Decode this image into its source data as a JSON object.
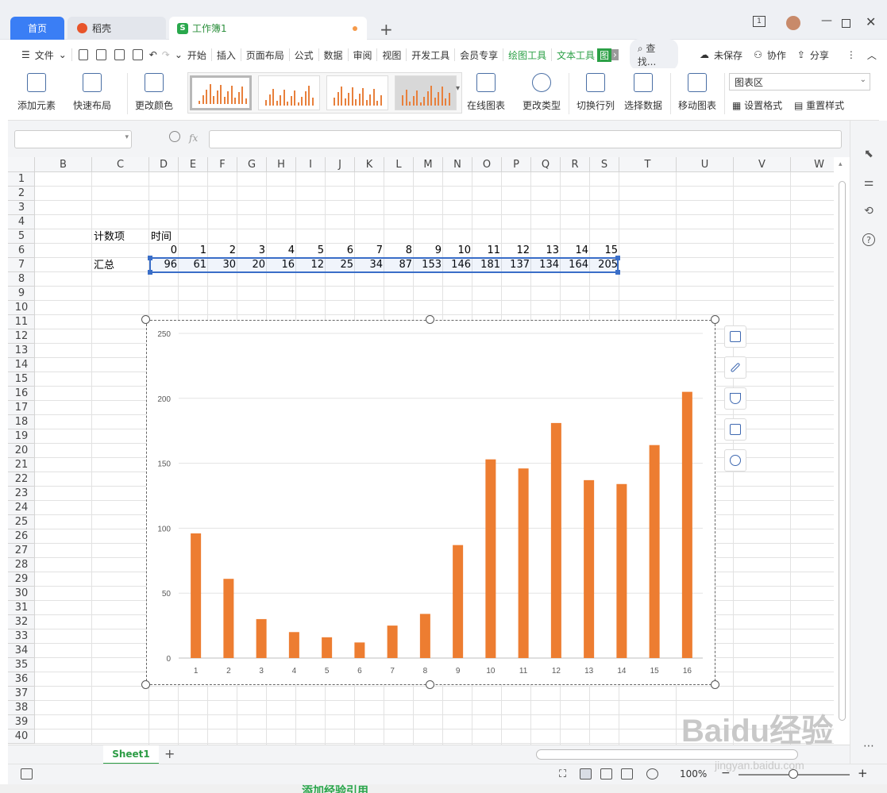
{
  "titlebar": {
    "tabs": [
      {
        "label": "首页"
      },
      {
        "label": "稻壳"
      },
      {
        "label": "工作簿1"
      }
    ],
    "window_badge": "1"
  },
  "menubar": {
    "file_label": "文件",
    "items": [
      "开始",
      "插入",
      "页面布局",
      "公式",
      "数据",
      "审阅",
      "视图",
      "开发工具",
      "会员专享"
    ],
    "context_items": [
      "绘图工具",
      "文本工具"
    ],
    "context_tab_chip": "图",
    "search_label": "查找...",
    "unsaved_label": "未保存",
    "collab_label": "协作",
    "share_label": "分享"
  },
  "ribbon": {
    "add_element": "添加元素",
    "quick_layout": "快速布局",
    "change_color": "更改颜色",
    "online_chart": "在线图表",
    "change_type": "更改类型",
    "switch_row_col": "切换行列",
    "select_data": "选择数据",
    "move_chart": "移动图表",
    "chart_area_select": "图表区",
    "set_format": "设置格式",
    "reset_style": "重置样式"
  },
  "formula_bar": {
    "fx_label": "fx",
    "name_box": "",
    "formula": ""
  },
  "sheet": {
    "columns": [
      "B",
      "C",
      "D",
      "E",
      "F",
      "G",
      "H",
      "I",
      "J",
      "K",
      "L",
      "M",
      "N",
      "O",
      "P",
      "Q",
      "R",
      "S",
      "T",
      "U",
      "V",
      "W"
    ],
    "rows": [
      "1",
      "2",
      "3",
      "4",
      "5",
      "6",
      "7",
      "8",
      "9",
      "10",
      "11",
      "12",
      "13",
      "14",
      "15",
      "16",
      "17",
      "18",
      "19",
      "20",
      "21",
      "22",
      "23",
      "24",
      "25",
      "26",
      "27",
      "28",
      "29",
      "30",
      "31",
      "32",
      "33",
      "34",
      "35",
      "36",
      "37",
      "38",
      "39",
      "40"
    ],
    "label_count": "计数项",
    "label_time": "时间",
    "label_total": "汇总",
    "time_values": [
      "0",
      "1",
      "2",
      "3",
      "4",
      "5",
      "6",
      "7",
      "8",
      "9",
      "10",
      "11",
      "12",
      "13",
      "14",
      "15"
    ],
    "total_values": [
      "96",
      "61",
      "30",
      "20",
      "16",
      "12",
      "25",
      "34",
      "87",
      "153",
      "146",
      "181",
      "137",
      "134",
      "164",
      "205"
    ]
  },
  "chart_data": {
    "type": "bar",
    "categories": [
      "1",
      "2",
      "3",
      "4",
      "5",
      "6",
      "7",
      "8",
      "9",
      "10",
      "11",
      "12",
      "13",
      "14",
      "15",
      "16"
    ],
    "values": [
      96,
      61,
      30,
      20,
      16,
      12,
      25,
      34,
      87,
      153,
      146,
      181,
      137,
      134,
      164,
      205
    ],
    "ylim": [
      0,
      250
    ],
    "yticks": [
      "0",
      "50",
      "100",
      "150",
      "200",
      "250"
    ],
    "grid": true,
    "bar_color": "#ed7d31"
  },
  "sheetbar": {
    "sheet_tab": "Sheet1",
    "add_sheet": "+"
  },
  "statusbar": {
    "zoom": "100%",
    "minus": "−",
    "plus": "+"
  },
  "page": {
    "below_text": "添加经验引用",
    "watermark": "Baidu经验",
    "watermark_sub": "jingyan.baidu.com"
  },
  "colors": {
    "accent_blue": "#3a7ef5",
    "wps_green": "#2ba046",
    "bar_orange": "#ed7d31"
  }
}
